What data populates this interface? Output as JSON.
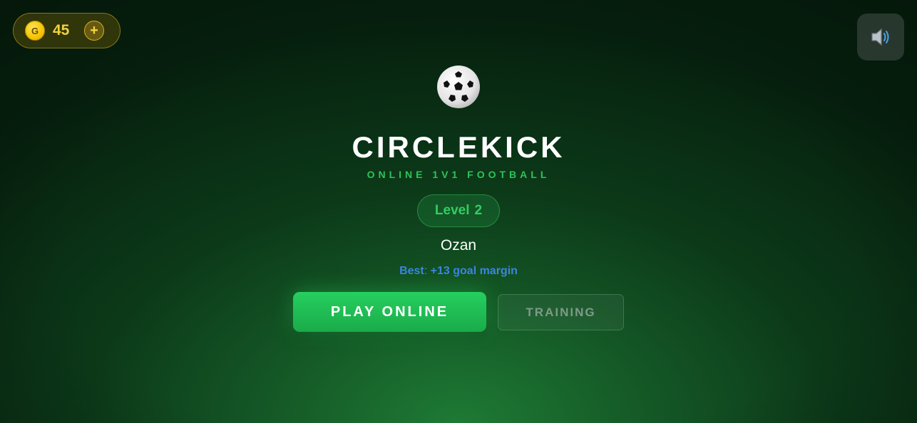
{
  "wallet": {
    "coin_symbol": "G",
    "amount": "45",
    "add_label": "+"
  },
  "sound": {
    "icon": "speaker-icon"
  },
  "hero": {
    "logo_icon": "soccer-ball-icon",
    "title": "CIRCLEKICK",
    "subtitle": "ONLINE 1V1 FOOTBALL"
  },
  "player": {
    "level_label": "Level",
    "level_value": "2",
    "name": "Ozan",
    "best_label": "Best",
    "best_sep": ":",
    "best_value": "+13 goal margin"
  },
  "actions": {
    "play_online": "PLAY ONLINE",
    "training": "TRAINING"
  },
  "colors": {
    "accent_green": "#22c55e",
    "coin_gold": "#f5c400",
    "best_blue": "#3a86e0"
  }
}
